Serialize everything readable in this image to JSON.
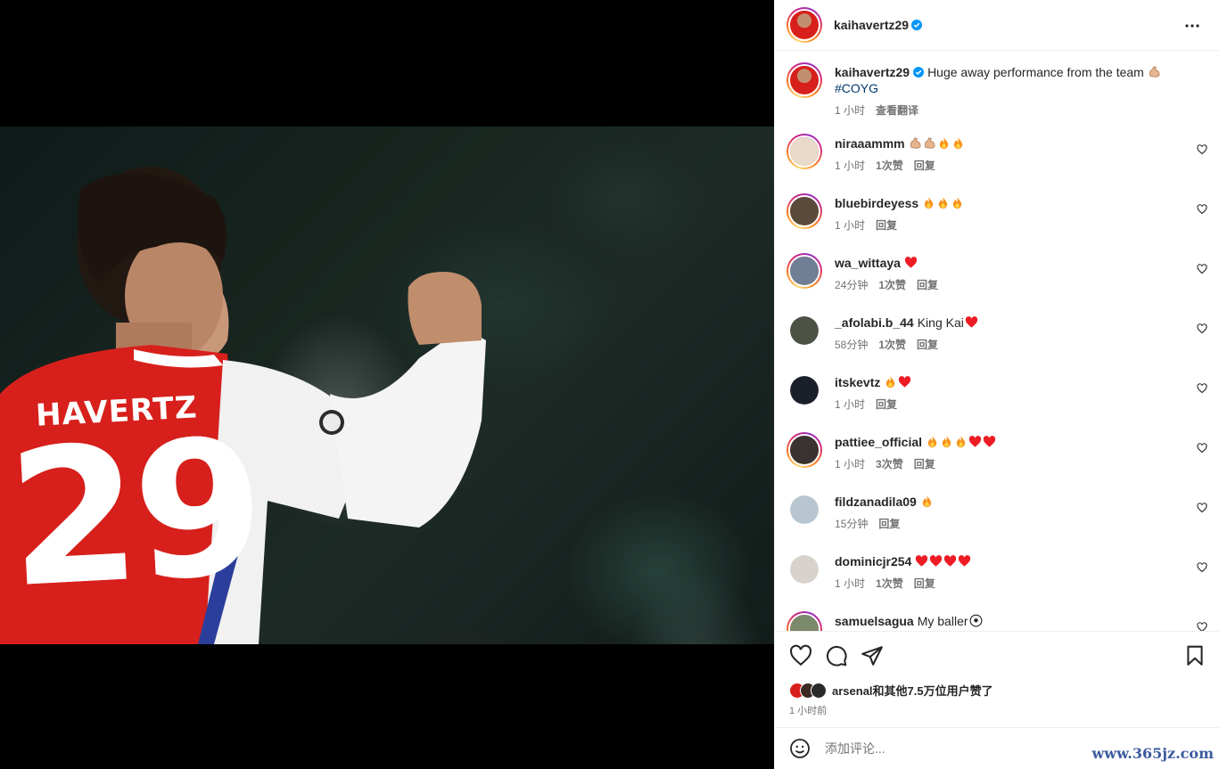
{
  "post": {
    "author": "kaihavertz29",
    "caption": "Huge away performance from the team",
    "caption_emoji": "flexed-biceps-icon",
    "hashtag": "#COYG",
    "time": "1 小时",
    "translate_label": "查看翻译"
  },
  "comments": [
    {
      "user": "niraaammm",
      "text": "",
      "emojis": [
        "flex",
        "flex",
        "fire",
        "fire"
      ],
      "time": "1 小时",
      "likes": "1次赞",
      "reply": "回复",
      "avatar_color": "#e9d9c8"
    },
    {
      "user": "bluebirdeyess",
      "text": "",
      "emojis": [
        "fire",
        "fire",
        "fire"
      ],
      "time": "1 小时",
      "likes": "",
      "reply": "回复",
      "avatar_color": "#5a4a3a"
    },
    {
      "user": "wa_wittaya",
      "text": "",
      "emojis": [
        "heart"
      ],
      "time": "24分钟",
      "likes": "1次赞",
      "reply": "回复",
      "avatar_color": "#6f7f95"
    },
    {
      "user": "_afolabi.b_44",
      "text": "King Kai",
      "emojis": [
        "heart"
      ],
      "time": "58分钟",
      "likes": "1次赞",
      "reply": "回复",
      "avatar_color": "#4c5244"
    },
    {
      "user": "itskevtz",
      "text": "",
      "emojis": [
        "fire",
        "heart"
      ],
      "time": "1 小时",
      "likes": "",
      "reply": "回复",
      "avatar_color": "#1b1f2a"
    },
    {
      "user": "pattiee_official",
      "text": "",
      "emojis": [
        "fire",
        "fire",
        "fire",
        "heart",
        "heart"
      ],
      "time": "1 小时",
      "likes": "3次赞",
      "reply": "回复",
      "avatar_color": "#3a3230"
    },
    {
      "user": "fildzanadila09",
      "text": "",
      "emojis": [
        "fire"
      ],
      "time": "15分钟",
      "likes": "",
      "reply": "回复",
      "avatar_color": "#b9c6cf"
    },
    {
      "user": "dominicjr254",
      "text": "",
      "emojis": [
        "heart",
        "heart",
        "heart",
        "heart"
      ],
      "time": "1 小时",
      "likes": "1次赞",
      "reply": "回复",
      "avatar_color": "#d8d2cc"
    },
    {
      "user": "samuelsagua",
      "text": "My baller",
      "emojis": [
        "ball"
      ],
      "time": "",
      "likes": "",
      "reply": "",
      "avatar_color": "#7b8a6a"
    }
  ],
  "likes_summary": "arsenal和其他7.5万位用户赞了",
  "posted_ago": "1 小时前",
  "comment_placeholder": "添加评论...",
  "watermark": "www.365jz.com",
  "jersey": {
    "name": "HAVERTZ",
    "number": "29"
  },
  "colors": {
    "verified": "#0095f6",
    "hashtag": "#00376b",
    "secondary_text": "#737373",
    "heart": "#ed4956",
    "fire": "#f7931e"
  }
}
